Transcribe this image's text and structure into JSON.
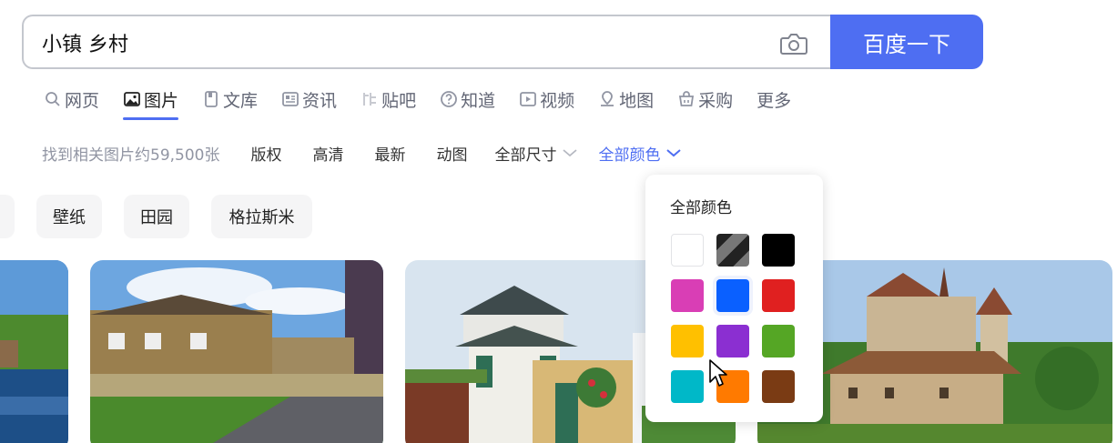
{
  "search": {
    "query": "小镇 乡村",
    "button_label": "百度一下"
  },
  "tabs": [
    {
      "label": "网页",
      "icon": "search-icon",
      "active": false
    },
    {
      "label": "图片",
      "icon": "image-icon",
      "active": true
    },
    {
      "label": "文库",
      "icon": "document-icon",
      "active": false
    },
    {
      "label": "资讯",
      "icon": "news-icon",
      "active": false
    },
    {
      "label": "贴吧",
      "icon": "tieba-icon",
      "active": false
    },
    {
      "label": "知道",
      "icon": "question-icon",
      "active": false
    },
    {
      "label": "视频",
      "icon": "video-icon",
      "active": false
    },
    {
      "label": "地图",
      "icon": "map-pin-icon",
      "active": false
    },
    {
      "label": "采购",
      "icon": "basket-icon",
      "active": false
    },
    {
      "label": "更多",
      "icon": "",
      "active": false
    }
  ],
  "filters": {
    "result_count": "找到相关图片约59,500张",
    "copyright": "版权",
    "hd": "高清",
    "newest": "最新",
    "animated": "动图",
    "size_dropdown": "全部尺寸",
    "color_dropdown": "全部颜色"
  },
  "chips": [
    "壁纸",
    "田园",
    "格拉斯米"
  ],
  "color_panel": {
    "title": "全部颜色",
    "swatches": [
      {
        "name": "white",
        "color": "#ffffff"
      },
      {
        "name": "black-white",
        "color": "#3a3a3a"
      },
      {
        "name": "black",
        "color": "#000000"
      },
      {
        "name": "pink",
        "color": "#d93eb5"
      },
      {
        "name": "blue",
        "color": "#0a60ff"
      },
      {
        "name": "red",
        "color": "#e02020"
      },
      {
        "name": "yellow",
        "color": "#ffc000"
      },
      {
        "name": "purple",
        "color": "#8b2fd1"
      },
      {
        "name": "green",
        "color": "#55a625"
      },
      {
        "name": "cyan",
        "color": "#00b8c8"
      },
      {
        "name": "orange",
        "color": "#ff7a00"
      },
      {
        "name": "brown",
        "color": "#7a3b14"
      }
    ],
    "selected": "blue"
  },
  "colors": {
    "accent": "#4e6ef2",
    "tab_text": "#626675",
    "muted_text": "#9195a3"
  }
}
